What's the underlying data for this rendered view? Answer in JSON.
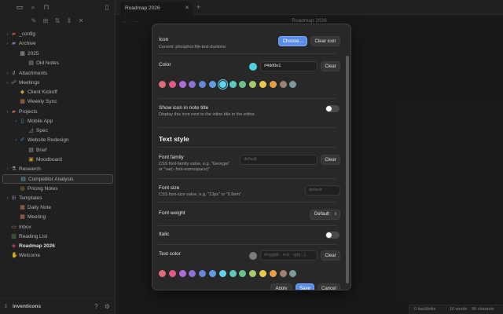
{
  "sidebar": {
    "vault_name": "inventicons",
    "tree": [
      {
        "label": "_config",
        "icon": "folder-icon",
        "color": "#c05a5a"
      },
      {
        "label": "Archive",
        "icon": "folder-icon",
        "color": "#a07ad0"
      },
      {
        "label": "2025",
        "icon": "calendar-icon",
        "color": "#bbbbbb"
      },
      {
        "label": "Old Notes",
        "icon": "note-icon",
        "color": "#bbbbbb"
      },
      {
        "label": "Attachments",
        "icon": "paperclip-icon",
        "color": "#bbbbbb"
      },
      {
        "label": "Meetings",
        "icon": "people-icon",
        "color": "#7aa0e6"
      },
      {
        "label": "Client Kickoff",
        "icon": "handshake-icon",
        "color": "#e6b84c"
      },
      {
        "label": "Weekly Sync",
        "icon": "calendar-icon",
        "color": "#e08a5a"
      },
      {
        "label": "Projects",
        "icon": "folder-icon",
        "color": "#d06a5a"
      },
      {
        "label": "Mobile App",
        "icon": "phone-icon",
        "color": "#5fb0e0"
      },
      {
        "label": "Spec",
        "icon": "ruler-icon",
        "color": "#bbbbbb"
      },
      {
        "label": "Website Redesign",
        "icon": "brush-icon",
        "color": "#5f8ee6"
      },
      {
        "label": "Brief",
        "icon": "document-icon",
        "color": "#bbbbbb"
      },
      {
        "label": "Moodboard",
        "icon": "image-icon",
        "color": "#e0b040"
      },
      {
        "label": "Research",
        "icon": "flask-icon",
        "color": "#bbbbbb"
      },
      {
        "label": "Competitor Analysis",
        "icon": "document-icon",
        "color": "#5fd4ea"
      },
      {
        "label": "Pricing Notes",
        "icon": "money-icon",
        "color": "#e6b84c"
      },
      {
        "label": "Templates",
        "icon": "template-icon",
        "color": "#a07ad0"
      },
      {
        "label": "Daily Note",
        "icon": "calendar-icon",
        "color": "#e08a5a"
      },
      {
        "label": "Meeting",
        "icon": "calendar-icon",
        "color": "#e08a5a"
      },
      {
        "label": "Inbox",
        "icon": "inbox-icon",
        "color": "#e08a5a"
      },
      {
        "label": "Reading List",
        "icon": "book-icon",
        "color": "#5fb05f"
      },
      {
        "label": "Roadmap 2026",
        "icon": "map-icon",
        "color": "#e05a5a"
      },
      {
        "label": "Welcome",
        "icon": "wave-icon",
        "color": "#e6b84c"
      }
    ]
  },
  "tabs": [
    {
      "label": "Roadmap 2026"
    }
  ],
  "note_title": "Roadmap 2026",
  "status": {
    "backlinks": "0 backlinks",
    "words": "16 words",
    "chars": "96 characte"
  },
  "modal": {
    "icon_label": "Icon",
    "icon_current": "Current: phosphor:file-text-duotone",
    "choose_button": "Choose...",
    "clear_icon_button": "Clear icon",
    "color_label": "Color",
    "color_value": "#4dd0e1",
    "color_clear": "Clear",
    "palette": [
      "#e06c75",
      "#e05a8a",
      "#b06cd6",
      "#8a72d6",
      "#6a86d6",
      "#5f9ee6",
      "#5fd4ea",
      "#5fc8c0",
      "#6ac48a",
      "#a6cc6a",
      "#e6c84c",
      "#e6a04c",
      "#a08070",
      "#7a9aa0"
    ],
    "picked_index": 6,
    "show_icon_label": "Show icon in note title",
    "show_icon_desc": "Display this icon next to the inline title in the editor.",
    "text_style_heading": "Text style",
    "font_family_label": "Font family",
    "font_family_desc_1": "CSS font-family value, e.g. \"Georgia\"",
    "font_family_desc_2": "or \"var(--font-monospace)\"",
    "font_family_placeholder": "default",
    "font_family_clear": "Clear",
    "font_size_label": "Font size",
    "font_size_desc": "CSS font-size value, e.g. \"13px\" or \"0.9em\"",
    "font_size_placeholder": "default",
    "font_weight_label": "Font weight",
    "font_weight_value": "Default",
    "italic_label": "Italic",
    "text_color_label": "Text color",
    "text_color_placeholder": "#rrggbb · red · rgb(...)",
    "text_color_clear": "Clear",
    "apply_button": "Apply",
    "save_button": "Save",
    "cancel_button": "Cancel"
  }
}
